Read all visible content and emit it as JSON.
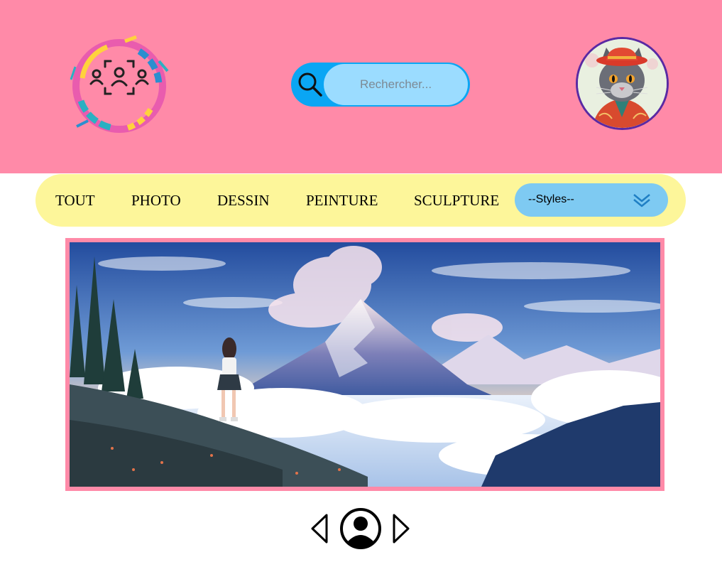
{
  "header": {
    "logo_icon": "people-focus-logo",
    "search": {
      "placeholder": "Rechercher...",
      "value": "",
      "icon": "search-icon"
    },
    "avatar_icon": "cat-avatar"
  },
  "nav": {
    "items": [
      {
        "label": "TOUT"
      },
      {
        "label": "PHOTO"
      },
      {
        "label": "DESSIN"
      },
      {
        "label": "PEINTURE"
      },
      {
        "label": "SCULPTURE"
      }
    ],
    "styles_select": {
      "selected": "--Styles--",
      "icon": "chevron-down-icon"
    }
  },
  "gallery": {
    "image_icon": "mountain-landscape",
    "controls": {
      "prev_icon": "chevron-left-icon",
      "center_icon": "user-circle-icon",
      "next_icon": "chevron-right-icon"
    }
  },
  "colors": {
    "header_bg": "#ff8aa8",
    "nav_bg": "#fdf69a",
    "search_bg": "#0aa6f4",
    "search_field_bg": "#9bdcff",
    "select_bg": "#7ecaf2",
    "frame": "#ff8aa8"
  }
}
